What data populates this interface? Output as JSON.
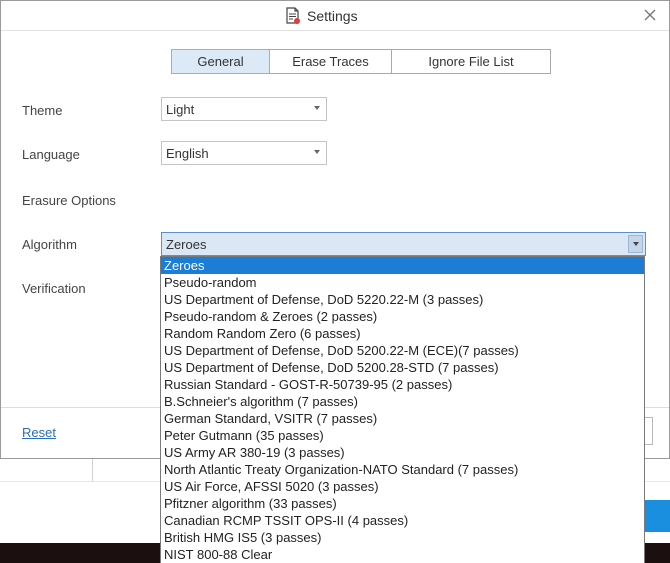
{
  "window": {
    "title": "Settings",
    "close_icon": "close-icon",
    "title_icon": "settings-document-icon"
  },
  "tabs": [
    {
      "label": "General",
      "active": true
    },
    {
      "label": "Erase Traces",
      "active": false
    },
    {
      "label": "Ignore File List",
      "active": false
    }
  ],
  "general": {
    "theme_label": "Theme",
    "theme_value": "Light",
    "language_label": "Language",
    "language_value": "English",
    "erasure_options_label": "Erasure Options",
    "algorithm_label": "Algorithm",
    "algorithm_value": "Zeroes",
    "verification_label": "Verification"
  },
  "algorithm_options": [
    "Zeroes",
    "Pseudo-random",
    "US Department of Defense, DoD 5220.22-M (3 passes)",
    "Pseudo-random & Zeroes (2 passes)",
    "Random Random Zero (6 passes)",
    "US Department of Defense, DoD 5200.22-M (ECE)(7 passes)",
    "US Department of Defense, DoD 5200.28-STD (7 passes)",
    "Russian Standard - GOST-R-50739-95 (2 passes)",
    "B.Schneier's algorithm (7 passes)",
    "German Standard, VSITR (7 passes)",
    "Peter Gutmann (35 passes)",
    "US Army AR 380-19 (3 passes)",
    "North Atlantic Treaty Organization-NATO Standard (7 passes)",
    "US Air Force, AFSSI 5020 (3 passes)",
    "Pfitzner algorithm (33 passes)",
    "Canadian RCMP TSSIT OPS-II (4 passes)",
    "British HMG IS5 (3 passes)",
    "NIST 800-88 Clear"
  ],
  "selected_option": "Zeroes",
  "footer": {
    "reset_label": "Reset"
  },
  "colors": {
    "accent": "#1c7dd6",
    "tab_active": "#dce9f6",
    "link": "#2a6fb5"
  }
}
